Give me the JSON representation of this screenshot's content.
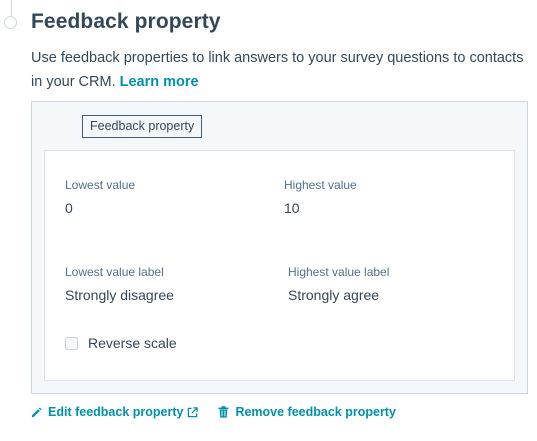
{
  "section": {
    "title": "Feedback property",
    "description": "Use feedback properties to link answers to your survey questions to contacts in your CRM.",
    "learn_more": "Learn more"
  },
  "property": {
    "tag": "Feedback property",
    "lowest_value": {
      "label": "Lowest value",
      "value": "0"
    },
    "highest_value": {
      "label": "Highest value",
      "value": "10"
    },
    "lowest_value_label": {
      "label": "Lowest value label",
      "value": "Strongly disagree"
    },
    "highest_value_label": {
      "label": "Highest value label",
      "value": "Strongly agree"
    },
    "reverse_scale": {
      "label": "Reverse scale",
      "checked": false
    }
  },
  "actions": {
    "edit": {
      "label": "Edit feedback property",
      "icon": "pencil-icon",
      "trailing_icon": "external-link-icon"
    },
    "remove": {
      "label": "Remove feedback property",
      "icon": "trash-icon"
    }
  },
  "colors": {
    "text": "#33475b",
    "label": "#516f90",
    "link": "#0091ae",
    "border": "#cbd6e2",
    "panel_bg": "#f5f8fa"
  }
}
